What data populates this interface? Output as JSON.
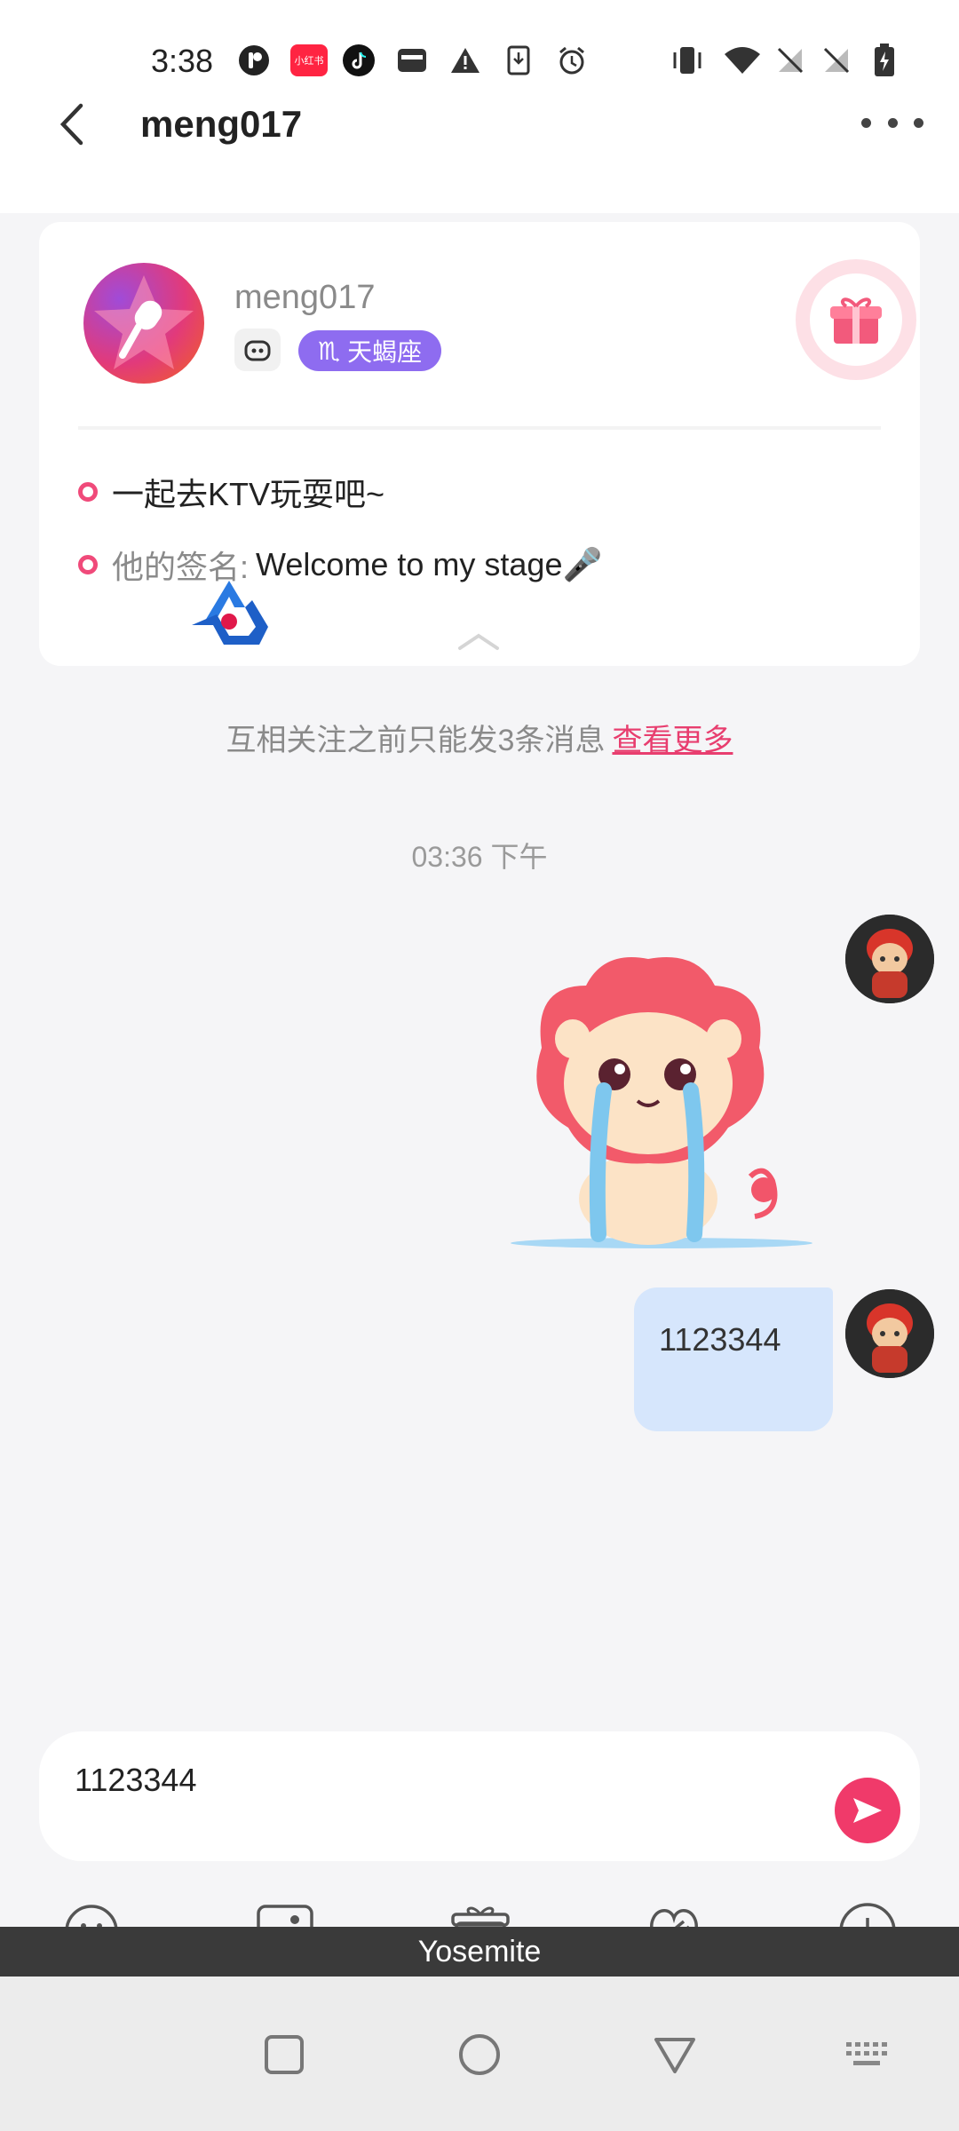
{
  "status_bar": {
    "time": "3:38",
    "xiaohongshu_label": "小红书"
  },
  "header": {
    "title": "meng017"
  },
  "profile": {
    "name": "meng017",
    "zodiac_symbol": "♏",
    "zodiac": "天蝎座",
    "line1": "一起去KTV玩耍吧~",
    "signature_label": "他的签名:",
    "signature_value": "Welcome to my stage🎤"
  },
  "chat": {
    "notice": "互相关注之前只能发3条消息",
    "notice_link": "查看更多",
    "time_separator": "03:36 下午",
    "messages": [
      {
        "type": "sticker",
        "sticker": "crying-lion"
      },
      {
        "type": "text",
        "text": "1123344"
      }
    ]
  },
  "composer": {
    "value": "1123344"
  },
  "keyboard": {
    "label": "Yosemite"
  },
  "colors": {
    "accent": "#f03a6a",
    "zodiac_bg": "#8e6cf0",
    "bubble": "#d6e6fc"
  }
}
